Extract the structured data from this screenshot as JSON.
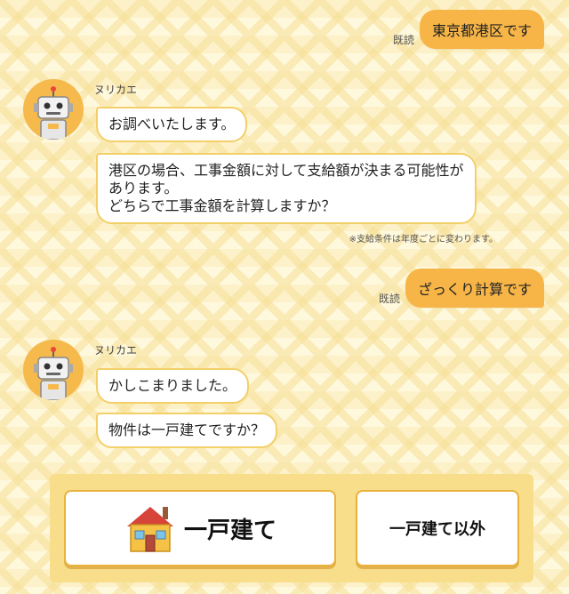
{
  "messages": {
    "user1": {
      "text": "東京都港区です",
      "read": "既読"
    },
    "bot1": {
      "name": "ヌリカエ",
      "bubble1": "お調べいたします。",
      "bubble2_lines": [
        "港区の場合、工事金額に対して支給額が決まる可能性が",
        "あります。",
        "どちらで工事金額を計算しますか？"
      ],
      "note": "※支給条件は年度ごとに変わります。"
    },
    "user2": {
      "text": "ざっくり計算です",
      "read": "既読"
    },
    "bot2": {
      "name": "ヌリカエ",
      "bubble1": "かしこまりました。",
      "bubble2": "物件は一戸建てですか？"
    }
  },
  "answers": {
    "detached": {
      "label": "一戸建て",
      "icon": "house-icon"
    },
    "other": {
      "label": "一戸建て以外"
    }
  },
  "colors": {
    "accent": "#f7b547",
    "bubble_border": "#f3cf68",
    "panel": "#f8dd8a",
    "background": "#fdf1c9"
  }
}
